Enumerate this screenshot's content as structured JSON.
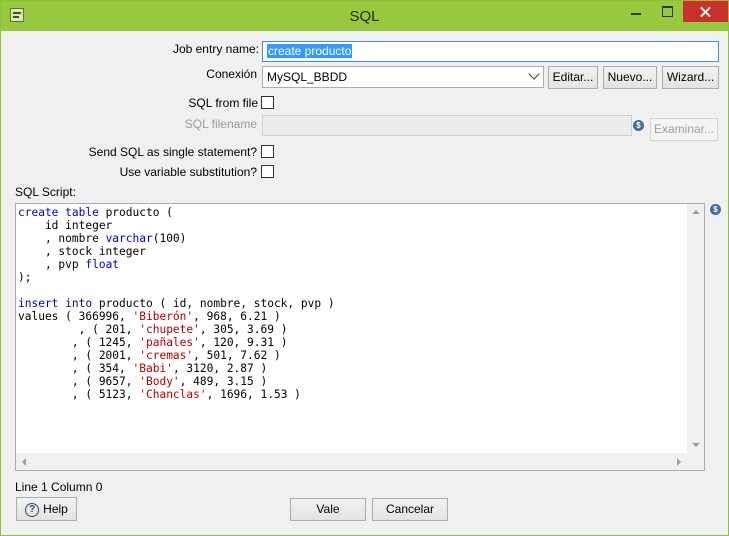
{
  "window": {
    "title": "SQL",
    "icon": "spoon-icon"
  },
  "form": {
    "job_entry_name_label": "Job entry name:",
    "job_entry_name_value": "create producto",
    "conexion_label": "Conexión",
    "conexion_value": "MySQL_BBDD",
    "editar_label": "Editar...",
    "nuevo_label": "Nuevo...",
    "wizard_label": "Wizard...",
    "sql_from_file_label": "SQL from file",
    "sql_from_file_checked": false,
    "sql_filename_label": "SQL filename",
    "sql_filename_value": "",
    "examinar_label": "Examinar...",
    "single_statement_label": "Send SQL as single statement?",
    "single_statement_checked": false,
    "variable_substitution_label": "Use variable substitution?",
    "variable_substitution_checked": false,
    "sql_script_label": "SQL Script:"
  },
  "script": {
    "lines": [
      [
        {
          "t": "create table",
          "c": "kw"
        },
        {
          "t": " producto (",
          "c": ""
        }
      ],
      [
        {
          "t": "    id integer",
          "c": ""
        }
      ],
      [
        {
          "t": "    , nombre ",
          "c": ""
        },
        {
          "t": "varchar",
          "c": "kw"
        },
        {
          "t": "(100)",
          "c": ""
        }
      ],
      [
        {
          "t": "    , stock integer",
          "c": ""
        }
      ],
      [
        {
          "t": "    , pvp ",
          "c": ""
        },
        {
          "t": "float",
          "c": "kw"
        }
      ],
      [
        {
          "t": ");",
          "c": ""
        }
      ],
      [
        {
          "t": "",
          "c": ""
        }
      ],
      [
        {
          "t": "insert into",
          "c": "kw"
        },
        {
          "t": " producto ( id, nombre, stock, pvp )",
          "c": ""
        }
      ],
      [
        {
          "t": "values ( 366996, ",
          "c": ""
        },
        {
          "t": "'Biberón'",
          "c": "str"
        },
        {
          "t": ", 968, 6.21 )",
          "c": ""
        }
      ],
      [
        {
          "t": "         , ( 201, ",
          "c": ""
        },
        {
          "t": "'chupete'",
          "c": "str"
        },
        {
          "t": ", 305, 3.69 )",
          "c": ""
        }
      ],
      [
        {
          "t": "        , ( 1245, ",
          "c": ""
        },
        {
          "t": "'pañales'",
          "c": "str"
        },
        {
          "t": ", 120, 9.31 )",
          "c": ""
        }
      ],
      [
        {
          "t": "        , ( 2001, ",
          "c": ""
        },
        {
          "t": "'cremas'",
          "c": "str"
        },
        {
          "t": ", 501, 7.62 )",
          "c": ""
        }
      ],
      [
        {
          "t": "        , ( 354, ",
          "c": ""
        },
        {
          "t": "'Babi'",
          "c": "str"
        },
        {
          "t": ", 3120, 2.87 )",
          "c": ""
        }
      ],
      [
        {
          "t": "        , ( 9657, ",
          "c": ""
        },
        {
          "t": "'Body'",
          "c": "str"
        },
        {
          "t": ", 489, 3.15 )",
          "c": ""
        }
      ],
      [
        {
          "t": "        , ( 5123, ",
          "c": ""
        },
        {
          "t": "'Chanclas'",
          "c": "str"
        },
        {
          "t": ", 1696, 1.53 )",
          "c": ""
        }
      ]
    ]
  },
  "status": {
    "position": "Line 1 Column 0"
  },
  "footer": {
    "help_label": "Help",
    "vale_label": "Vale",
    "cancelar_label": "Cancelar"
  }
}
